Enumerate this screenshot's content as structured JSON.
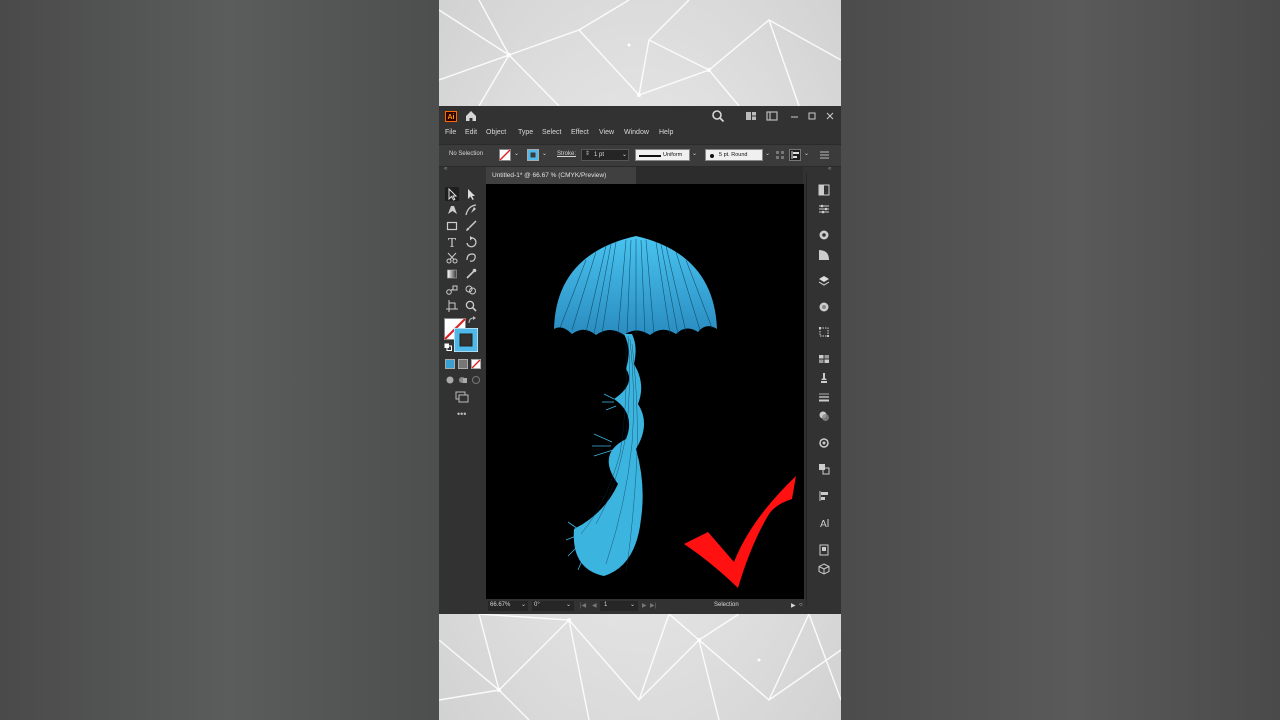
{
  "app": {
    "logo_text": "Ai"
  },
  "menu": [
    "File",
    "Edit",
    "Object",
    "Type",
    "Select",
    "Effect",
    "View",
    "Window",
    "Help"
  ],
  "control_bar": {
    "selection_label": "No Selection",
    "stroke_label": "Stroke:",
    "stroke_value": "1 pt",
    "profile_value": "Uniform",
    "brush_value": "5 pt. Round"
  },
  "document": {
    "tab_title": "Untitled-1* @ 66.67 % (CMYK/Preview)"
  },
  "status": {
    "zoom": "66.67%",
    "rotation": "0°",
    "artboard_number": "1",
    "current_tool": "Selection"
  },
  "colors": {
    "jellyfish": "#3cb4e0",
    "checkmark": "#ff1111",
    "stroke_swatch": "#4fb8e8"
  },
  "icons": {
    "titlebar": [
      "home-icon",
      "search-icon",
      "arrange-documents-icon",
      "panel-layout-icon",
      "minimize-icon",
      "maximize-icon",
      "close-icon"
    ],
    "tools": [
      "selection-tool-icon",
      "direct-selection-tool-icon",
      "pen-tool-icon",
      "curvature-tool-icon",
      "rectangle-tool-icon",
      "paintbrush-tool-icon",
      "type-tool-icon",
      "rotate-tool-icon",
      "scissors-tool-icon",
      "warp-tool-icon",
      "gradient-tool-icon",
      "eyedropper-tool-icon",
      "blend-tool-icon",
      "shape-builder-tool-icon",
      "artboard-tool-icon",
      "zoom-tool-icon"
    ]
  }
}
